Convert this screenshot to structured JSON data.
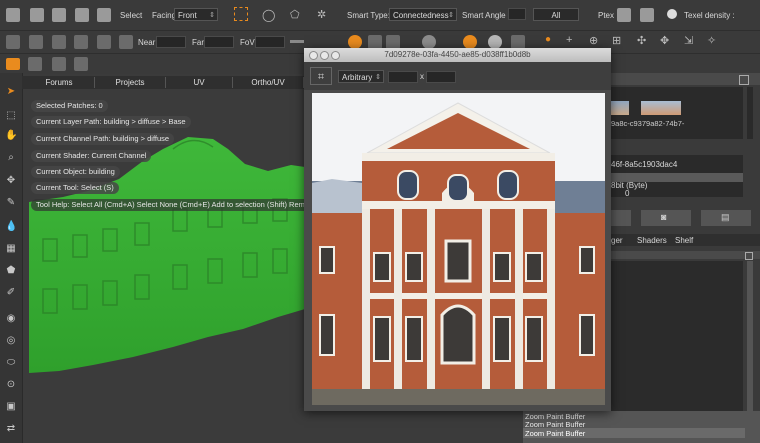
{
  "toolbar1": {
    "select_label": "Select",
    "facing_label": "Facing",
    "facing_value": "Front",
    "smart_type_label": "Smart Type:",
    "smart_type_value": "Connectedness",
    "smart_angle_label": "Smart Angle",
    "all_value": "All",
    "ptex_label": "Ptex",
    "texel_density_label": "Texel density :"
  },
  "toolbar2": {
    "near_label": "Near",
    "far_label": "Far",
    "fov_label": "FoV"
  },
  "tabs": [
    "Forums",
    "Projects",
    "UV",
    "Ortho/UV"
  ],
  "overlay": {
    "selected_patches": "Selected Patches: 0",
    "layer_path": "Current Layer Path: building > diffuse > Base",
    "channel_path": "Current Channel Path: building > diffuse",
    "shader": "Current Shader: Current Channel",
    "object": "Current Object: building",
    "tool": "Current Tool: Select (S)",
    "tool_help": "Tool Help: Select All (Cmd+A)   Select None (Cmd+E)   Add to selection (Shift)   Remo"
  },
  "image_window": {
    "title": "7d09278e-03fa-4450-ae85-d038ff1b0d8b",
    "mode_value": "Arbitrary",
    "x_label": "x"
  },
  "right_panel": {
    "thumb_caption": "9a8c-c9379a82-74b7-",
    "list_item1": "46f-8a5c1903dac4",
    "list_item2": "8bit (Byte)",
    "list_item3": "0",
    "tabs": [
      "ger",
      "Shaders",
      "Shelf"
    ],
    "log": [
      "Zoom Paint Buffer",
      "Zoom Paint Buffer",
      "Zoom Paint Buffer"
    ]
  }
}
